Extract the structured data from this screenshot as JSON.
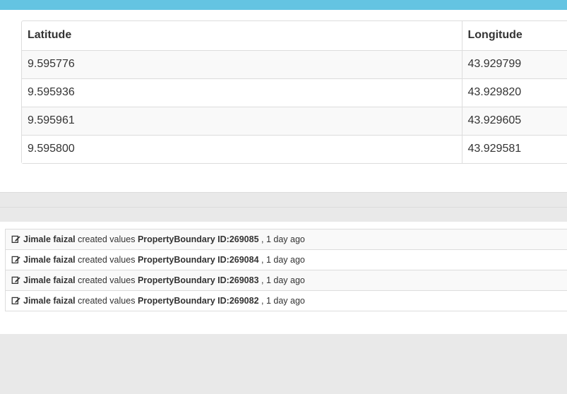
{
  "table": {
    "headers": [
      "Latitude",
      "Longitude"
    ],
    "rows": [
      {
        "lat": "9.595776",
        "lng": "43.929799"
      },
      {
        "lat": "9.595936",
        "lng": "43.929820"
      },
      {
        "lat": "9.595961",
        "lng": "43.929605"
      },
      {
        "lat": "9.595800",
        "lng": "43.929581"
      }
    ]
  },
  "activity": {
    "items": [
      {
        "user": "Jimale faizal",
        "action": "created values",
        "target": "PropertyBoundary ID:269085",
        "time": ", 1 day ago"
      },
      {
        "user": "Jimale faizal",
        "action": "created values",
        "target": "PropertyBoundary ID:269084",
        "time": ", 1 day ago"
      },
      {
        "user": "Jimale faizal",
        "action": "created values",
        "target": "PropertyBoundary ID:269083",
        "time": ", 1 day ago"
      },
      {
        "user": "Jimale faizal",
        "action": "created values",
        "target": "PropertyBoundary ID:269082",
        "time": ", 1 day ago"
      }
    ]
  },
  "colors": {
    "header_band": "#64c4e2",
    "page_background": "#e9e9e9"
  },
  "icons": {
    "activity_item": "edit-icon"
  }
}
